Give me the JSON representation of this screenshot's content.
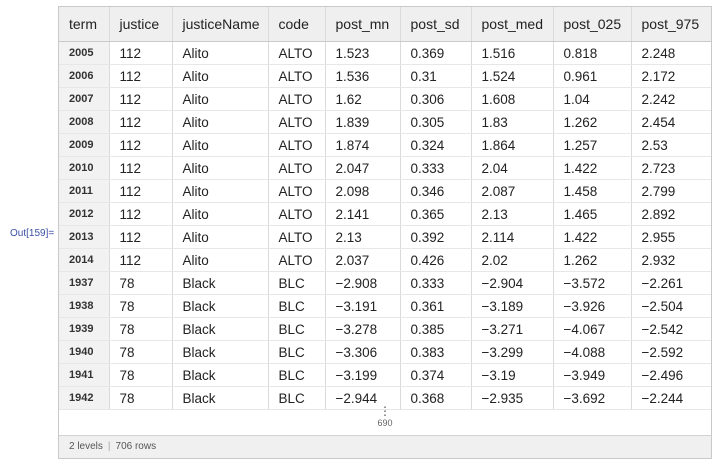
{
  "out_label": "Out[159]=",
  "columns": [
    "term",
    "justice",
    "justiceName",
    "code",
    "post_mn",
    "post_sd",
    "post_med",
    "post_025",
    "post_975"
  ],
  "rows": [
    [
      "2005",
      "112",
      "Alito",
      "ALTO",
      "1.523",
      "0.369",
      "1.516",
      "0.818",
      "2.248"
    ],
    [
      "2006",
      "112",
      "Alito",
      "ALTO",
      "1.536",
      "0.31",
      "1.524",
      "0.961",
      "2.172"
    ],
    [
      "2007",
      "112",
      "Alito",
      "ALTO",
      "1.62",
      "0.306",
      "1.608",
      "1.04",
      "2.242"
    ],
    [
      "2008",
      "112",
      "Alito",
      "ALTO",
      "1.839",
      "0.305",
      "1.83",
      "1.262",
      "2.454"
    ],
    [
      "2009",
      "112",
      "Alito",
      "ALTO",
      "1.874",
      "0.324",
      "1.864",
      "1.257",
      "2.53"
    ],
    [
      "2010",
      "112",
      "Alito",
      "ALTO",
      "2.047",
      "0.333",
      "2.04",
      "1.422",
      "2.723"
    ],
    [
      "2011",
      "112",
      "Alito",
      "ALTO",
      "2.098",
      "0.346",
      "2.087",
      "1.458",
      "2.799"
    ],
    [
      "2012",
      "112",
      "Alito",
      "ALTO",
      "2.141",
      "0.365",
      "2.13",
      "1.465",
      "2.892"
    ],
    [
      "2013",
      "112",
      "Alito",
      "ALTO",
      "2.13",
      "0.392",
      "2.114",
      "1.422",
      "2.955"
    ],
    [
      "2014",
      "112",
      "Alito",
      "ALTO",
      "2.037",
      "0.426",
      "2.02",
      "1.262",
      "2.932"
    ],
    [
      "1937",
      "78",
      "Black",
      "BLC",
      "−2.908",
      "0.333",
      "−2.904",
      "−3.572",
      "−2.261"
    ],
    [
      "1938",
      "78",
      "Black",
      "BLC",
      "−3.191",
      "0.361",
      "−3.189",
      "−3.926",
      "−2.504"
    ],
    [
      "1939",
      "78",
      "Black",
      "BLC",
      "−3.278",
      "0.385",
      "−3.271",
      "−4.067",
      "−2.542"
    ],
    [
      "1940",
      "78",
      "Black",
      "BLC",
      "−3.306",
      "0.383",
      "−3.299",
      "−4.088",
      "−2.592"
    ],
    [
      "1941",
      "78",
      "Black",
      "BLC",
      "−3.199",
      "0.374",
      "−3.19",
      "−3.949",
      "−2.496"
    ],
    [
      "1942",
      "78",
      "Black",
      "BLC",
      "−2.944",
      "0.368",
      "−2.935",
      "−3.692",
      "−2.244"
    ]
  ],
  "more": {
    "ellipsis": "⋮",
    "count": "690"
  },
  "footer": {
    "levels": "2 levels",
    "separator": "|",
    "rows": "706 rows"
  }
}
